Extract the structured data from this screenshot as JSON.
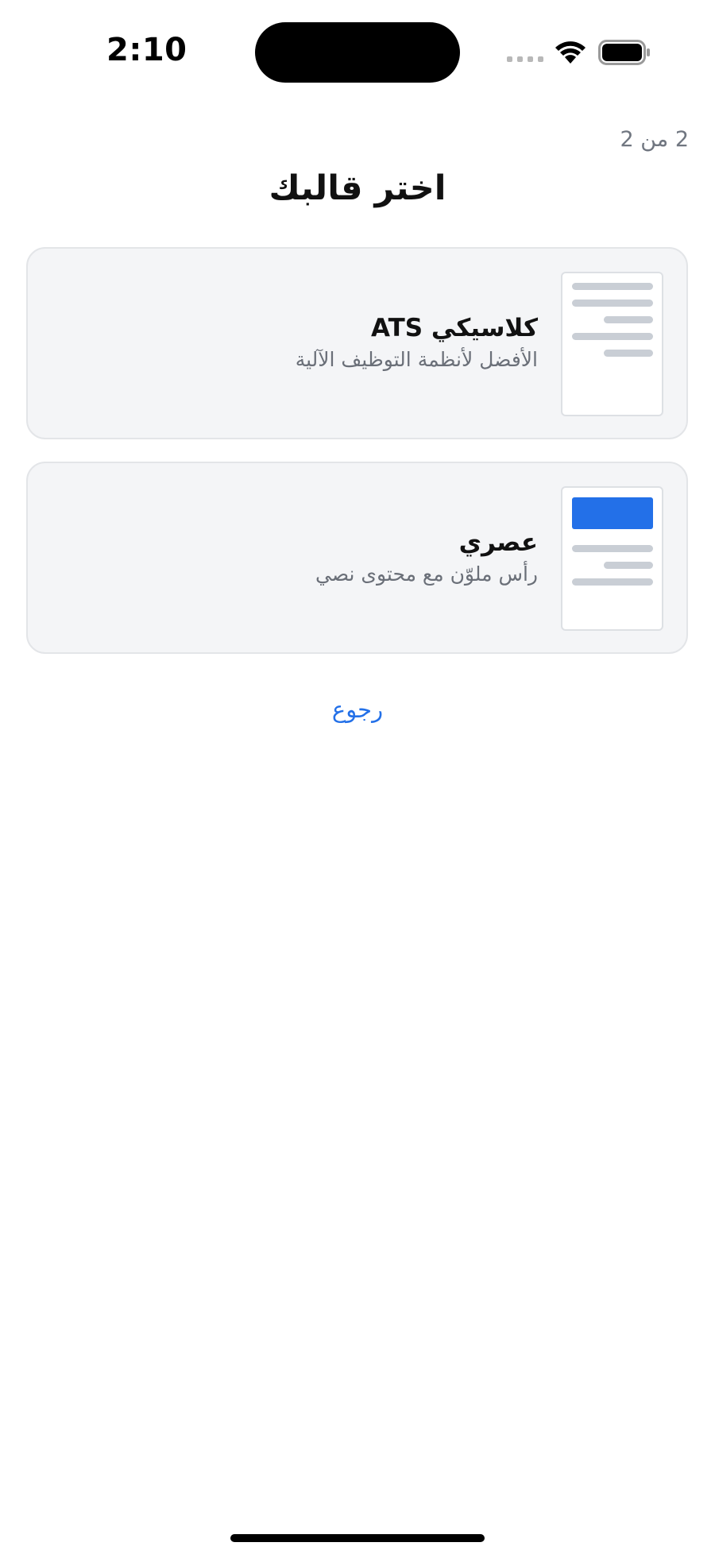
{
  "status_bar": {
    "time": "2:10"
  },
  "header": {
    "step": "2 من 2",
    "title": "اختر قالبك"
  },
  "templates": [
    {
      "title": "كلاسيكي ATS",
      "description": "الأفضل لأنظمة التوظيف الآلية",
      "thumbnail": "plain-lines"
    },
    {
      "title": "عصري",
      "description": "رأس ملوّن مع محتوى نصي",
      "thumbnail": "colored-header",
      "accent_color": "#2370e8"
    }
  ],
  "footer": {
    "back_label": "رجوع"
  },
  "colors": {
    "link": "#2370e8",
    "card_background": "#f4f5f7",
    "card_border": "#e3e5e8",
    "muted_text": "#6a6f78"
  }
}
